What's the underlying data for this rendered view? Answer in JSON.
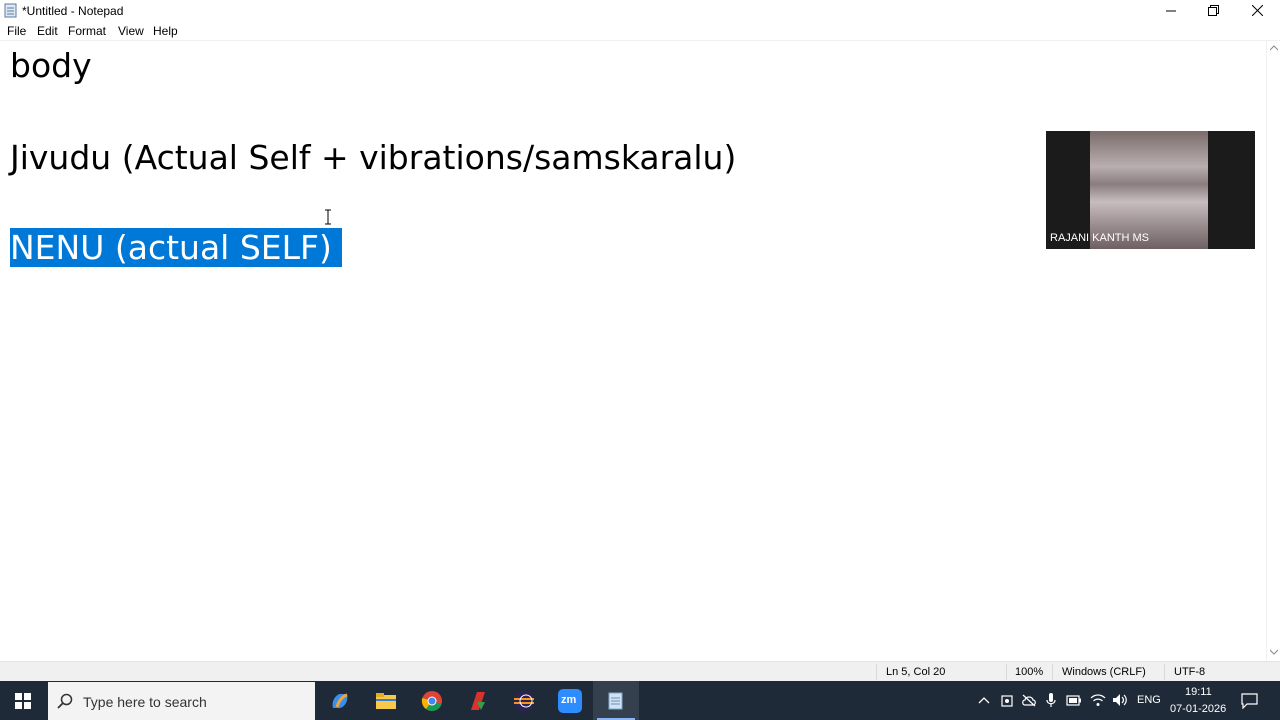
{
  "window": {
    "title": "*Untitled - Notepad"
  },
  "menu": [
    "File",
    "Edit",
    "Format",
    "View",
    "Help"
  ],
  "editor": {
    "lines": [
      "body",
      "Jivudu (Actual Self + vibrations/samskaralu)",
      "NENU (actual SELF)"
    ],
    "selected_line_index": 2
  },
  "status": {
    "position": "Ln 5, Col 20",
    "zoom": "100%",
    "line_ending": "Windows (CRLF)",
    "encoding": "UTF-8"
  },
  "video": {
    "participant": "RAJANI KANTH MS"
  },
  "taskbar": {
    "search_placeholder": "Type here to search",
    "apps": [
      "copilot-icon",
      "file-explorer-icon",
      "chrome-icon",
      "app-icon",
      "eclipse-icon",
      "zoom-icon",
      "notepad-icon"
    ],
    "zoom_label": "zm",
    "language": "ENG",
    "time": "19:11",
    "date": "07-01-2026"
  },
  "colors": {
    "selection": "#0078d7",
    "taskbar": "#1f2a38"
  }
}
